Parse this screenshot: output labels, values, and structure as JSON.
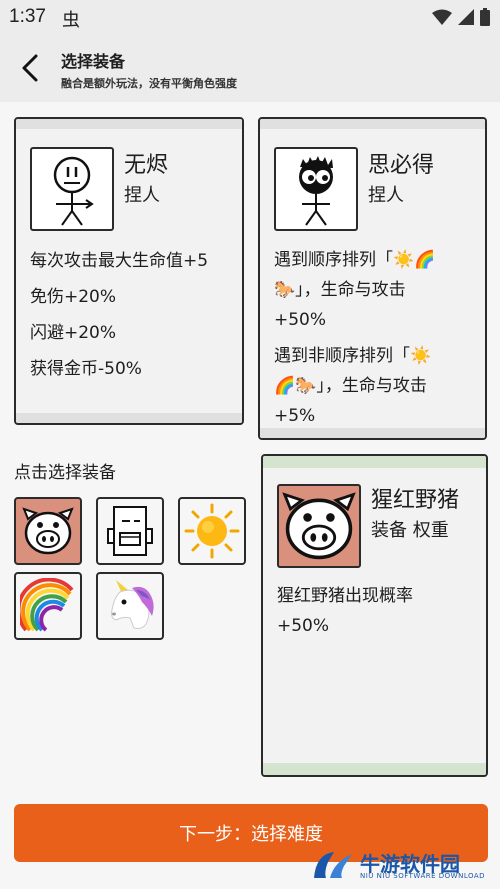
{
  "status_bar": {
    "time": "1:37",
    "app_icon": "虫"
  },
  "header": {
    "title": "选择装备",
    "subtitle": "融合是额外玩法，没有平衡角色强度"
  },
  "characters": [
    {
      "name": "无烬",
      "type": "捏人",
      "effects": [
        "每次攻击最大生命值+5",
        "免伤+20%",
        "闪避+20%",
        "获得金币-50%"
      ]
    },
    {
      "name": "思必得",
      "type": "捏人",
      "effects": [
        "遇到顺序排列「☀️🌈",
        "🐎」，生命与攻击",
        "+50%",
        "遇到非顺序排列「☀️",
        "🌈🐎」，生命与攻击",
        "+5%"
      ]
    }
  ],
  "equipment_section": {
    "label": "点击选择装备",
    "items": [
      {
        "icon": "pig-face-icon",
        "selected": true
      },
      {
        "icon": "robot-icon",
        "selected": false
      },
      {
        "icon": "sun-icon",
        "selected": false
      },
      {
        "icon": "rainbow-icon",
        "selected": false
      },
      {
        "icon": "unicorn-icon",
        "selected": false
      }
    ]
  },
  "selected_equipment": {
    "name": "猩红野猪",
    "type": "装备 权重",
    "effects": [
      "猩红野猪出现概率",
      "+50%"
    ]
  },
  "next_button": {
    "label": "下一步：选择难度"
  },
  "watermark": {
    "text": "牛游软件园",
    "sub": "NIU NIU SOFTWARE DOWNLOAD"
  },
  "colors": {
    "accent": "#e8601a",
    "selected_bg": "#d9917e",
    "card_border": "#2b2b2b"
  }
}
